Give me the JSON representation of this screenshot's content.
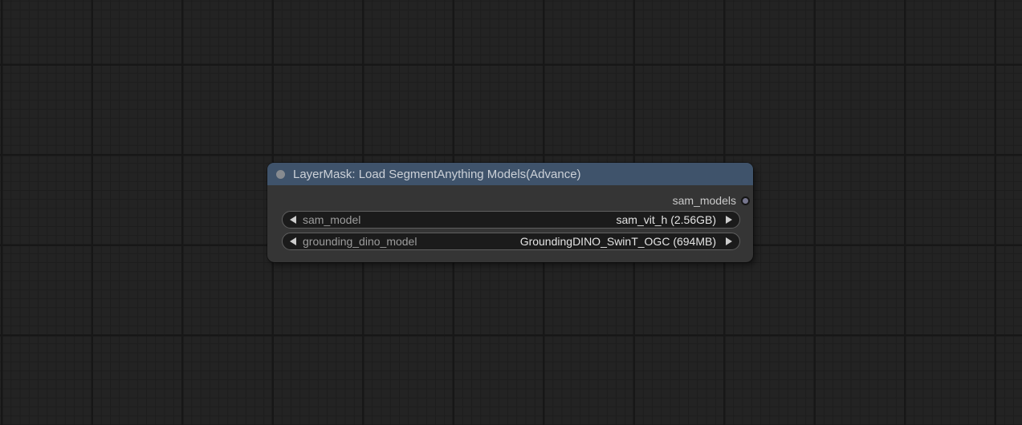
{
  "canvas": {
    "background_color": "#232323",
    "grid_minor_color": "#1d1d1d",
    "grid_major_color": "#171717"
  },
  "node": {
    "title": "LayerMask: Load SegmentAnything Models(Advance)",
    "header_color": "#3f536b",
    "body_color": "#353535",
    "collapse_dot_color": "#878b90",
    "outputs": [
      {
        "label": "sam_models",
        "dot_color": "#76768e"
      }
    ],
    "widgets": [
      {
        "label": "sam_model",
        "value": "sam_vit_h (2.56GB)"
      },
      {
        "label": "grounding_dino_model",
        "value": "GroundingDINO_SwinT_OGC (694MB)"
      }
    ],
    "icons": {
      "collapse_dot": "circle",
      "output_slot": "circle",
      "combo_left_arrow": "left-triangle",
      "combo_right_arrow": "right-triangle"
    }
  }
}
